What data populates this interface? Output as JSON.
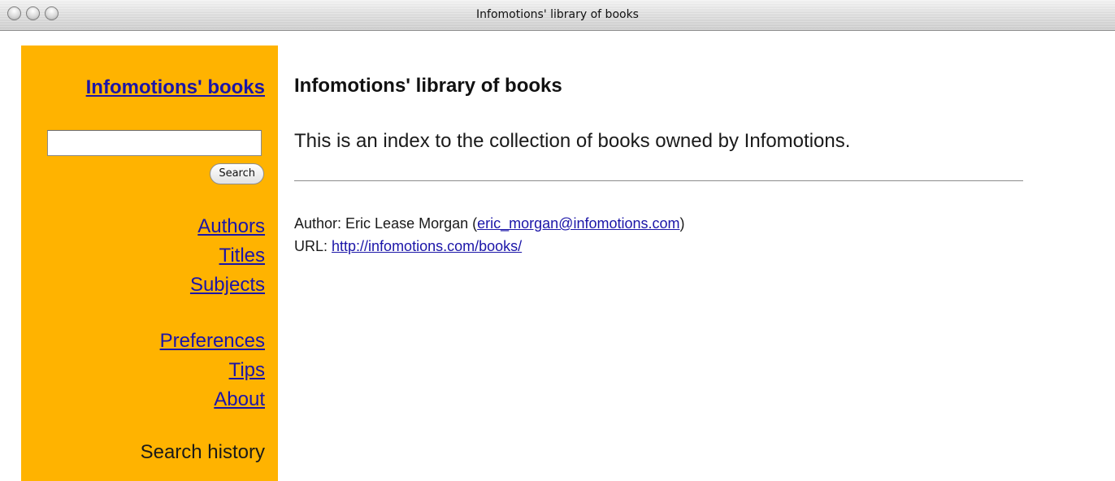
{
  "window": {
    "title": "Infomotions' library of books"
  },
  "sidebar": {
    "brand": "Infomotions' books",
    "search": {
      "value": "",
      "placeholder": "",
      "button_label": "Search"
    },
    "nav_primary": [
      "Authors",
      "Titles",
      "Subjects"
    ],
    "nav_secondary": [
      "Preferences",
      "Tips",
      "About"
    ],
    "search_history": "Search history"
  },
  "main": {
    "title": "Infomotions' library of books",
    "intro": "This is an index to the collection of books owned by Infomotions.",
    "author_label": "Author: ",
    "author_name": "Eric Lease Morgan (",
    "author_email": "eric_morgan@infomotions.com",
    "author_close": ")",
    "url_label": "URL: ",
    "url": "http://infomotions.com/books/"
  },
  "colors": {
    "sidebar_bg": "#ffb300",
    "link": "#1b15a8"
  }
}
